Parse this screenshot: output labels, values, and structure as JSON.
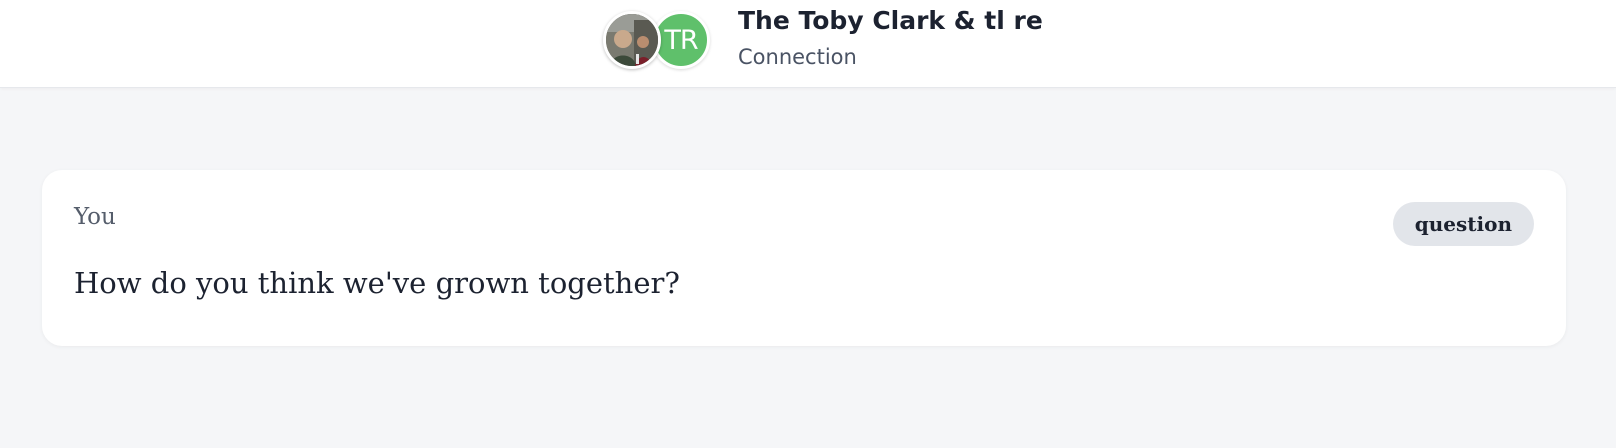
{
  "header": {
    "avatar_initials": "TR",
    "title": "The Toby Clark & tl re",
    "subtitle": "Connection"
  },
  "card": {
    "author": "You",
    "tag": "question",
    "message": "How do you think we've grown together?"
  },
  "colors": {
    "page_background": "#f5f6f8",
    "initials_avatar": "#5fc06b",
    "tag_background": "#e2e5ea",
    "text_primary": "#1c2230",
    "text_secondary": "#4a5364"
  }
}
